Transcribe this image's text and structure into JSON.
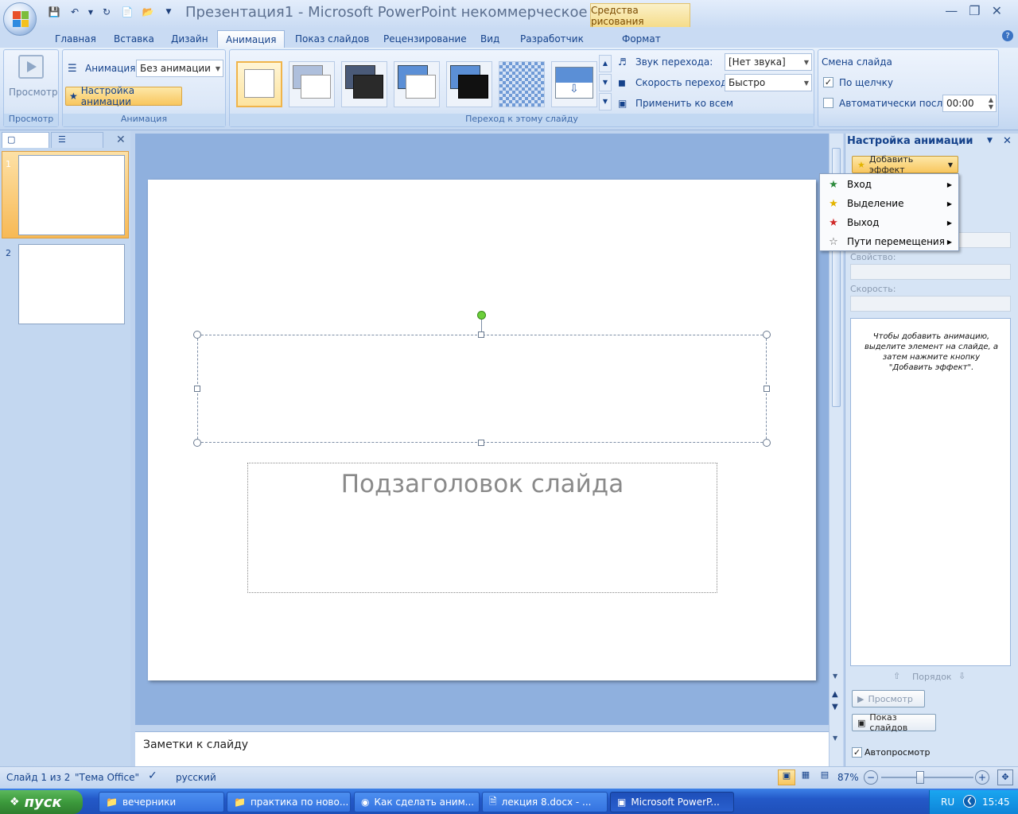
{
  "window": {
    "title": "Презентация1 - Microsoft PowerPoint некоммерческое ...",
    "context_tab": "Средства рисования"
  },
  "tabs": [
    "Главная",
    "Вставка",
    "Дизайн",
    "Анимация",
    "Показ слайдов",
    "Рецензирование",
    "Вид",
    "Разработчик",
    "Формат"
  ],
  "active_tab": "Анимация",
  "ribbon": {
    "preview": {
      "button": "Просмотр",
      "group": "Просмотр"
    },
    "animation": {
      "label": "Анимация:",
      "value": "Без анимации",
      "custom": "Настройка анимации",
      "group": "Анимация"
    },
    "transition": {
      "group": "Переход к этому слайду",
      "sound_label": "Звук перехода:",
      "sound_value": "[Нет звука]",
      "speed_label": "Скорость перехода:",
      "speed_value": "Быстро",
      "apply_all": "Применить ко всем"
    },
    "advance": {
      "title": "Смена слайда",
      "on_click": "По щелчку",
      "on_click_checked": true,
      "auto_after": "Автоматически после:",
      "auto_value": "00:00",
      "auto_checked": false
    }
  },
  "slides_pane": {
    "numbers": [
      "1",
      "2"
    ]
  },
  "slide": {
    "subtitle_placeholder": "Подзаголовок слайда"
  },
  "notes": {
    "placeholder": "Заметки к слайду"
  },
  "task_pane": {
    "title": "Настройка анимации",
    "add_effect": "Добавить эффект",
    "property_label": "Свойство:",
    "speed_label": "Скорость:",
    "hint": "Чтобы добавить анимацию, выделите элемент на слайде, а затем нажмите кнопку \"Добавить эффект\".",
    "order": "Порядок",
    "preview": "Просмотр",
    "slideshow": "Показ слайдов",
    "autopreview": "Автопросмотр",
    "autopreview_checked": true
  },
  "menu": {
    "items": [
      {
        "label": "Вход",
        "icon": "entrance-star-icon",
        "color": "#2e8b3e"
      },
      {
        "label": "Выделение",
        "icon": "emphasis-star-icon",
        "color": "#e3b400"
      },
      {
        "label": "Выход",
        "icon": "exit-star-icon",
        "color": "#d02a2a"
      },
      {
        "label": "Пути перемещения",
        "icon": "motion-path-star-icon",
        "color": "#555555"
      }
    ]
  },
  "status": {
    "slide": "Слайд 1 из 2",
    "theme": "\"Тема Office\"",
    "language": "русский",
    "zoom": "87%"
  },
  "taskbar": {
    "start": "пуск",
    "tasks": [
      "вечерники",
      "практика по ново...",
      "Как сделать аним...",
      "лекция 8.docx - ...",
      "Microsoft PowerP..."
    ],
    "lang": "RU",
    "clock": "15:45"
  }
}
